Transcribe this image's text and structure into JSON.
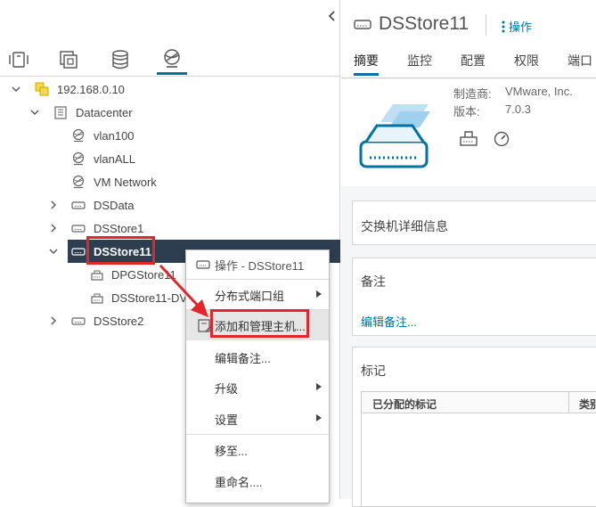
{
  "left_panel": {
    "collapse_icon": "chevron-left-icon",
    "top_tabs": [
      {
        "name": "hosts-clusters-tab",
        "icon": "hosts-icon"
      },
      {
        "name": "vms-templates-tab",
        "icon": "vms-icon"
      },
      {
        "name": "storage-tab",
        "icon": "storage-icon"
      },
      {
        "name": "networking-tab",
        "icon": "networking-icon",
        "active": true
      }
    ],
    "tree": {
      "vcenter": "192.168.0.10",
      "datacenter": "Datacenter",
      "networks": [
        "vlan100",
        "vlanALL",
        "VM Network"
      ],
      "switches": [
        "DSData",
        "DSStore1",
        "DSStore11",
        "DSStore2"
      ],
      "selected": "DSStore11",
      "portgroups": [
        "DPGStore11",
        "DSStore11-DV"
      ]
    }
  },
  "context_menu": {
    "header": "操作 - DSStore11",
    "items": [
      {
        "label": "分布式端口组",
        "submenu": true
      },
      {
        "label": "添加和管理主机...",
        "highlighted": true
      },
      {
        "label": "编辑备注..."
      },
      {
        "label": "升级",
        "submenu": true
      },
      {
        "label": "设置",
        "submenu": true
      },
      {
        "label": "移至..."
      },
      {
        "label": "重命名...."
      }
    ]
  },
  "right_panel": {
    "title": "DSStore11",
    "actions_label": "操作",
    "tabs": [
      "摘要",
      "监控",
      "配置",
      "权限",
      "端口"
    ],
    "active_tab": "摘要",
    "summary": {
      "manufacturer_label": "制造商:",
      "manufacturer_value": "VMware, Inc.",
      "version_label": "版本:",
      "version_value": "7.0.3"
    },
    "switch_details_title": "交换机详细信息",
    "notes_title": "备注",
    "edit_notes_link": "编辑备注...",
    "tags_title": "标记",
    "tags_table_headers": [
      "已分配的标记",
      "类别"
    ]
  },
  "colors": {
    "accent": "#0072a3",
    "selected_bg": "#2c3e50",
    "highlight_red": "#e3262b"
  }
}
